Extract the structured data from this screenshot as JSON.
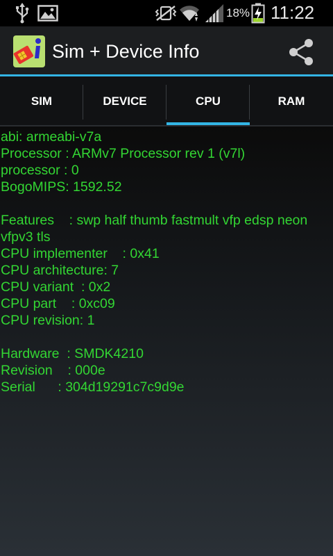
{
  "status_bar": {
    "battery_percent": "18%",
    "time": "11:22",
    "icons": [
      "usb-icon",
      "image-icon",
      "mute-vibrate-icon",
      "wifi-icon",
      "signal-icon",
      "battery-charging-icon"
    ]
  },
  "app": {
    "title": "Sim + Device Info",
    "icon": "sim-info-app-icon",
    "share_icon": "share-icon",
    "accent_color": "#33b5e5",
    "text_color": "#33d633"
  },
  "tabs": [
    {
      "label": "SIM",
      "selected": false
    },
    {
      "label": "DEVICE",
      "selected": false
    },
    {
      "label": "CPU",
      "selected": true
    },
    {
      "label": "RAM",
      "selected": false
    }
  ],
  "cpu_info": {
    "abi": "abi: armeabi-v7a",
    "processor_name": "Processor : ARMv7 Processor rev 1 (v7l)",
    "processor_index": "processor : 0",
    "bogomips": "BogoMIPS: 1592.52",
    "features": "Features    : swp half thumb fastmult vfp edsp neon vfpv3 tls",
    "implementer": "CPU implementer    : 0x41",
    "architecture": "CPU architecture: 7",
    "variant": "CPU variant  : 0x2",
    "part": "CPU part    : 0xc09",
    "revision": "CPU revision: 1",
    "hardware": "Hardware  : SMDK4210",
    "board_revision": "Revision    : 000e",
    "serial": "Serial      : 304d19291c7c9d9e"
  }
}
